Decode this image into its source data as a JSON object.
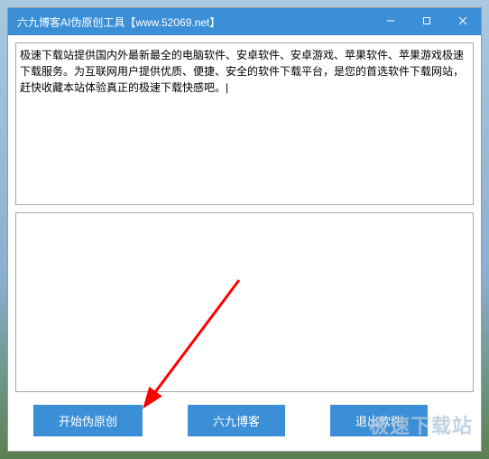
{
  "titlebar": {
    "title": "六九博客AI伪原创工具【www.52069.net】"
  },
  "input": {
    "value": "极速下载站提供国内外最新最全的电脑软件、安卓软件、安卓游戏、苹果软件、苹果游戏极速下载服务。为互联网用户提供优质、便捷、安全的软件下载平台，是您的首选软件下载网站，赶快收藏本站体验真正的极速下载快感吧。|"
  },
  "output": {
    "value": ""
  },
  "buttons": {
    "start": "开始伪原创",
    "blog": "六九博客",
    "exit": "退出软件"
  },
  "watermark": "极速下载站"
}
